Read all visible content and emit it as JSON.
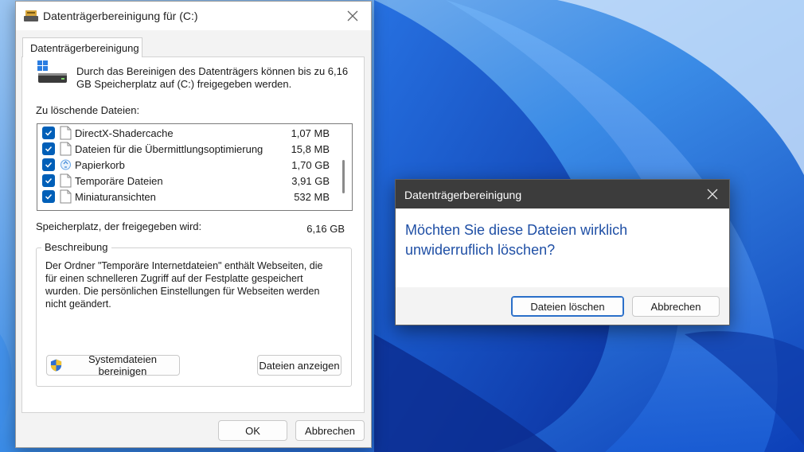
{
  "main_window": {
    "title": "Datenträgerbereinigung für  (C:)",
    "tab_label": "Datenträgerbereinigung",
    "intro_text": "Durch das Bereinigen des Datenträgers können bis zu 6,16 GB Speicherplatz auf  (C:) freigegeben werden.",
    "files_label": "Zu löschende Dateien:",
    "files": [
      {
        "name": "DirectX-Shadercache",
        "size": "1,07 MB",
        "checked": true,
        "icon": "file-icon"
      },
      {
        "name": "Dateien für die Übermittlungsoptimierung",
        "size": "15,8 MB",
        "checked": true,
        "icon": "file-icon"
      },
      {
        "name": "Papierkorb",
        "size": "1,70 GB",
        "checked": true,
        "icon": "recycle-bin-icon"
      },
      {
        "name": "Temporäre Dateien",
        "size": "3,91 GB",
        "checked": true,
        "icon": "file-icon"
      },
      {
        "name": "Miniaturansichten",
        "size": "532 MB",
        "checked": true,
        "icon": "file-icon"
      }
    ],
    "space_label": "Speicherplatz, der freigegeben wird:",
    "space_value": "6,16 GB",
    "description": {
      "title": "Beschreibung",
      "text": "Der Ordner \"Temporäre Internetdateien\" enthält Webseiten, die für einen schnelleren Zugriff auf der Festplatte gespeichert wurden. Die persönlichen Einstellungen für Webseiten werden nicht geändert."
    },
    "buttons": {
      "system_cleanup": "Systemdateien bereinigen",
      "show_files": "Dateien anzeigen",
      "ok": "OK",
      "cancel": "Abbrechen"
    }
  },
  "confirm_dialog": {
    "title": "Datenträgerbereinigung",
    "message": "Möchten Sie diese Dateien wirklich unwiderruflich löschen?",
    "buttons": {
      "delete": "Dateien löschen",
      "cancel": "Abbrechen"
    }
  },
  "colors": {
    "accent": "#005fb8",
    "message_text": "#1f4fa5",
    "confirm_titlebar": "#3c3c3c",
    "wallpaper_blue": "#2d7ee0"
  }
}
